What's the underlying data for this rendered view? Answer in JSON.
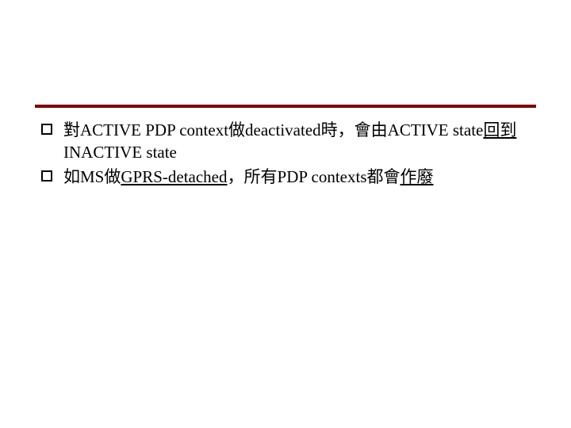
{
  "items": [
    {
      "part1": "對ACTIVE PDP context做deactivated時，會由ACTIVE state",
      "part2": "回到",
      "part3": "INACTIVE state"
    },
    {
      "part1": "如MS做",
      "part2": "GPRS-detached",
      "part3": "，所有PDP contexts都會",
      "part4": "作廢"
    }
  ]
}
